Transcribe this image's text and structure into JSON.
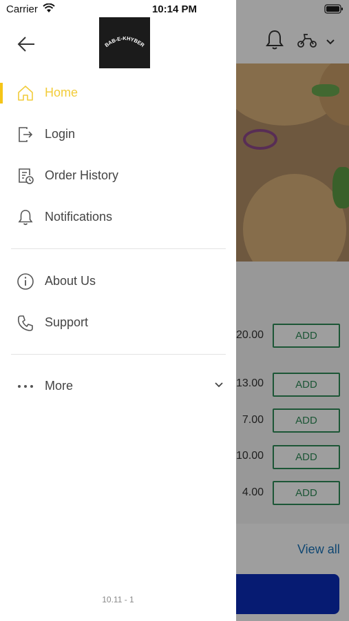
{
  "status": {
    "carrier": "Carrier",
    "time": "10:14 PM"
  },
  "drawer": {
    "logo_text": "BAB-E-KHYBER",
    "items": [
      {
        "label": "Home",
        "icon": "home-icon",
        "active": true
      },
      {
        "label": "Login",
        "icon": "login-icon"
      },
      {
        "label": "Order History",
        "icon": "order-history-icon"
      },
      {
        "label": "Notifications",
        "icon": "bell-icon"
      },
      {
        "label": "About Us",
        "icon": "info-icon"
      },
      {
        "label": "Support",
        "icon": "phone-icon"
      },
      {
        "label": "More",
        "icon": "more-dots-icon"
      }
    ],
    "version": "10.11 - 1",
    "active_color": "#f2cc3a"
  },
  "background": {
    "prices": [
      "20.00",
      "13.00",
      "7.00",
      "10.00",
      "4.00"
    ],
    "add_label": "ADD",
    "view_all": "View all",
    "accent": "#2e8b57",
    "cta_color": "#0a2db8"
  }
}
